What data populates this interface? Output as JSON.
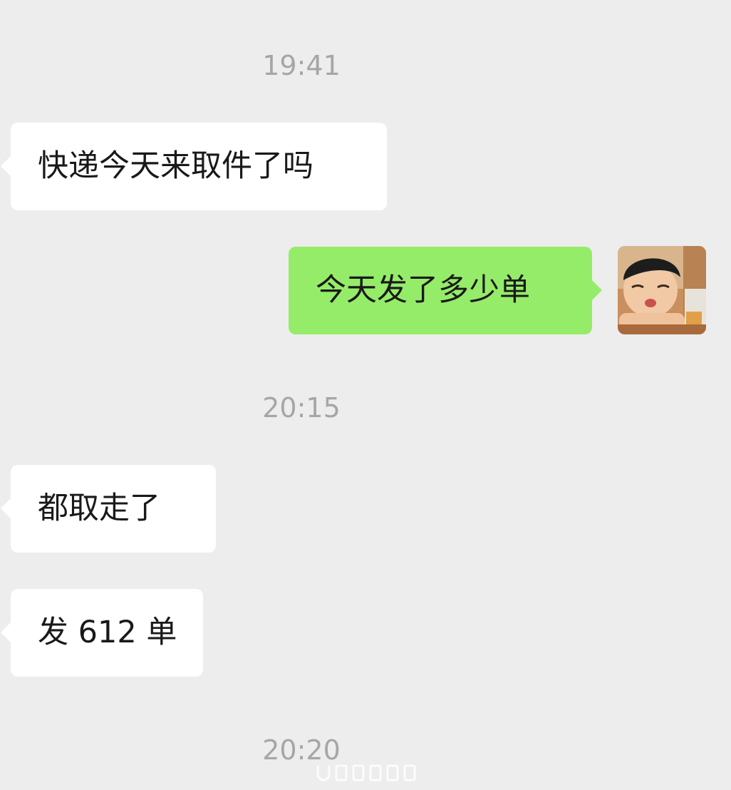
{
  "conversation": {
    "timestamps": [
      "19:41",
      "20:15",
      "20:20"
    ],
    "messages": [
      {
        "side": "incoming",
        "text": "快递今天来取件了吗"
      },
      {
        "side": "outgoing",
        "text": "今天发了多少单"
      },
      {
        "side": "incoming",
        "text": "都取走了"
      },
      {
        "side": "incoming",
        "text": "发 612 单"
      }
    ],
    "self_avatar": {
      "icon": "boy-avatar-photo"
    }
  },
  "colors": {
    "background": "#ededed",
    "incoming_bubble": "#ffffff",
    "outgoing_bubble": "#95ec69",
    "timestamp_text": "#a6a6a6",
    "message_text": "#191919"
  }
}
